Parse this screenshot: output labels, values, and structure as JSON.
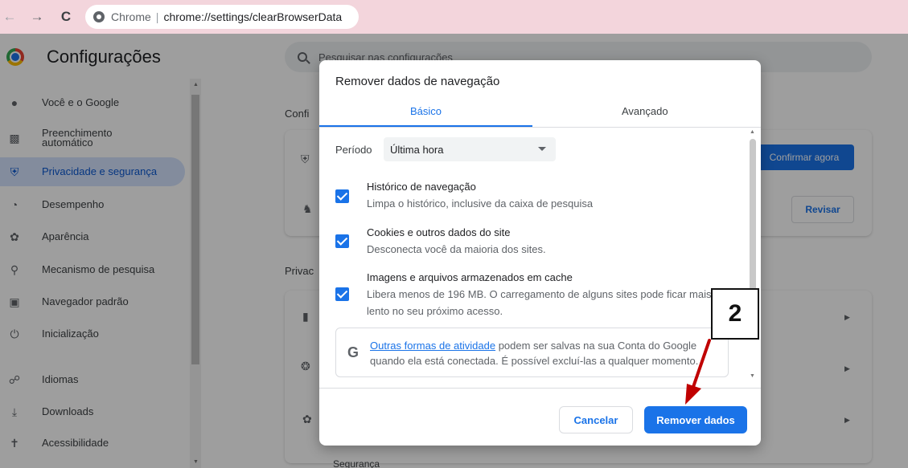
{
  "browser": {
    "nav_back": "←",
    "nav_forward": "→",
    "nav_reload": "C",
    "omnibox_site": "Chrome",
    "omnibox_separator": "|",
    "omnibox_url": "chrome://settings/clearBrowserData"
  },
  "settings": {
    "title": "Configurações",
    "search_placeholder": "Pesquisar nas configurações",
    "sidebar": [
      {
        "label": "Você e o Google",
        "icon": "person-icon"
      },
      {
        "label": "Preenchimento automático",
        "icon": "clipboard-icon"
      },
      {
        "label": "Privacidade e segurança",
        "icon": "shield-icon",
        "active": true
      },
      {
        "label": "Desempenho",
        "icon": "speedometer-icon"
      },
      {
        "label": "Aparência",
        "icon": "palette-icon"
      },
      {
        "label": "Mecanismo de pesquisa",
        "icon": "search-icon"
      },
      {
        "label": "Navegador padrão",
        "icon": "browser-icon"
      },
      {
        "label": "Inicialização",
        "icon": "power-icon"
      },
      {
        "label": "Idiomas",
        "icon": "globe-icon"
      },
      {
        "label": "Downloads",
        "icon": "download-icon"
      },
      {
        "label": "Acessibilidade",
        "icon": "accessibility-icon"
      }
    ],
    "background": {
      "section1_label": "Confi",
      "section2_label": "Privac",
      "confirm_button": "Confirmar agora",
      "review_button": "Revisar",
      "bottom_item": "Segurança"
    }
  },
  "dialog": {
    "title": "Remover dados de navegação",
    "tabs": [
      {
        "label": "Básico",
        "active": true
      },
      {
        "label": "Avançado",
        "active": false
      }
    ],
    "period": {
      "label": "Período",
      "value": "Última hora"
    },
    "options": [
      {
        "title": "Histórico de navegação",
        "description": "Limpa o histórico, inclusive da caixa de pesquisa",
        "checked": true
      },
      {
        "title": "Cookies e outros dados do site",
        "description": "Desconecta você da maioria dos sites.",
        "checked": true
      },
      {
        "title": "Imagens e arquivos armazenados em cache",
        "description": "Libera menos de 196 MB. O carregamento de alguns sites pode ficar mais lento no seu próximo acesso.",
        "checked": true
      }
    ],
    "info": {
      "icon": "G",
      "link": "Outras formas de atividade",
      "text": " podem ser salvas na sua Conta do Google quando ela está conectada. É possível excluí-las a qualquer momento."
    },
    "cancel_button": "Cancelar",
    "remove_button": "Remover dados"
  },
  "annotation": {
    "step_number": "2",
    "color": "#c00000"
  }
}
